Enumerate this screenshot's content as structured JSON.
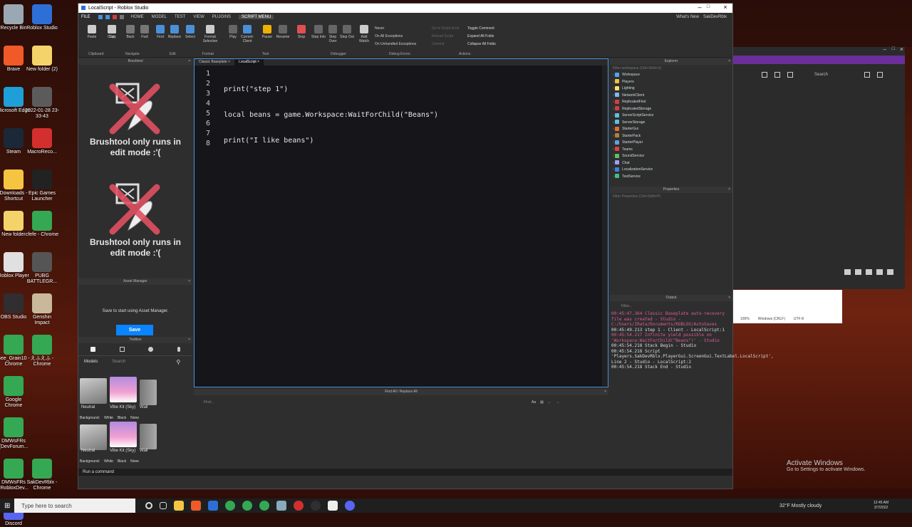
{
  "desktop": [
    {
      "label": "Recycle Bin",
      "color": "#9aa8b3"
    },
    {
      "label": "Roblox Studio",
      "color": "#2d6fd6"
    },
    {
      "label": "Brave",
      "color": "#f05a28"
    },
    {
      "label": "New folder (2)",
      "color": "#f5d36b"
    },
    {
      "label": "Microsoft Edge",
      "color": "#1e9fd8"
    },
    {
      "label": "2022-01-28 23-33-43",
      "color": "#5b5b5b"
    },
    {
      "label": "Steam",
      "color": "#1b2838"
    },
    {
      "label": "MacroReco...",
      "color": "#d32f2f"
    },
    {
      "label": "Downloads - Shortcut",
      "color": "#f5c542"
    },
    {
      "label": "Epic Games Launcher",
      "color": "#222"
    },
    {
      "label": "New folder",
      "color": "#f5d36b"
    },
    {
      "label": "cfefe - Chrome",
      "color": "#34a853"
    },
    {
      "label": "Roblox Player",
      "color": "#e0e0e0"
    },
    {
      "label": "PUBG BATTLEGR...",
      "color": "#555"
    },
    {
      "label": "OBS Studio",
      "color": "#302e31"
    },
    {
      "label": "Genshin Impact",
      "color": "#c9b99a"
    },
    {
      "label": "Bee_Grain10 - Chrome",
      "color": "#34a853"
    },
    {
      "label": "えふえふ - Chrome",
      "color": "#34a853"
    },
    {
      "label": "Google Chrome",
      "color": "#34a853"
    },
    {
      "label": "",
      "color": "#000"
    },
    {
      "label": "DMWsFRs (DevForum...",
      "color": "#34a853"
    },
    {
      "label": "",
      "color": "#000"
    },
    {
      "label": "DMWsFRs (RobloxDev...",
      "color": "#34a853"
    },
    {
      "label": "SakDevRblx - Chrome",
      "color": "#34a853"
    },
    {
      "label": "Discord",
      "color": "#5865f2"
    }
  ],
  "window": {
    "title": "LocalScript - Roblox Studio",
    "whats_new": "What's New",
    "user": "SakDevRblx"
  },
  "menu": [
    "FILE",
    "HOME",
    "MODEL",
    "TEST",
    "VIEW",
    "PLUGINS",
    "SCRIPT MENU"
  ],
  "ribbon": {
    "buttons": [
      "Paste",
      "Cut",
      "Copy",
      "Back",
      "Fwd",
      "Find",
      "Replace",
      "Select",
      "Format Selection",
      "Play",
      "Current: Client",
      "Pause",
      "Resume",
      "Stop",
      "Step Into",
      "Step Over",
      "Step Out",
      "Add Watch"
    ],
    "groups": [
      "Clipboard",
      "Navigate",
      "Edit",
      "Format",
      "Test",
      "Debugger",
      "Debug Errors",
      "Actions"
    ],
    "debug_errors": [
      "Never",
      "On All Exceptions",
      "On Unhandled Exceptions"
    ],
    "actions_left": [
      "Go to Script Error",
      "Reload Script",
      "Commit"
    ],
    "actions": [
      "Toggle Comment",
      "Expand All Folds",
      "Collapse All Folds"
    ]
  },
  "brushtool": {
    "title": "Brushtool",
    "message": "Brushtool only runs in edit mode :'("
  },
  "asset_manager": {
    "title": "Asset Manager",
    "message": "Save to start using Asset Manager.",
    "save": "Save"
  },
  "toolbox": {
    "title": "Toolbox",
    "category": "Models",
    "search": "Search",
    "items": [
      "Neutral",
      "Vibe Kit (Sky)",
      "Wall"
    ],
    "bg_label": "Background:",
    "bg_options": [
      "White",
      "Black",
      "None"
    ]
  },
  "editor": {
    "tabs": [
      "Classic Baseplate",
      "LocalScript"
    ],
    "lines": [
      "print(\"step 1\")",
      "local beans = game.Workspace:WaitForChild(\"Beans\")",
      "print(\"I like beans\")",
      "",
      "",
      "",
      "",
      ""
    ]
  },
  "explorer": {
    "title": "Explorer",
    "filter": "Filter workspace (Ctrl+Shift+X)",
    "items": [
      {
        "label": "Workspace",
        "color": "#4fa3ff"
      },
      {
        "label": "Players",
        "color": "#f0c040"
      },
      {
        "label": "Lighting",
        "color": "#f5e26b"
      },
      {
        "label": "NetworkClient",
        "color": "#7fb8ff"
      },
      {
        "label": "ReplicatedFirst",
        "color": "#d04040"
      },
      {
        "label": "ReplicatedStorage",
        "color": "#d04040"
      },
      {
        "label": "ServerScriptService",
        "color": "#60c0e0"
      },
      {
        "label": "ServerStorage",
        "color": "#60c0e0"
      },
      {
        "label": "StarterGui",
        "color": "#e07030"
      },
      {
        "label": "StarterPack",
        "color": "#b08040"
      },
      {
        "label": "StarterPlayer",
        "color": "#60a0e0"
      },
      {
        "label": "Teams",
        "color": "#e04040"
      },
      {
        "label": "SoundService",
        "color": "#60c060"
      },
      {
        "label": "Chat",
        "color": "#a0a0ff"
      },
      {
        "label": "LocalizationService",
        "color": "#4080e0"
      },
      {
        "label": "TestService",
        "color": "#40c080"
      }
    ]
  },
  "properties": {
    "title": "Properties",
    "filter": "Filter Properties (Ctrl+Shift+P)"
  },
  "output": {
    "title": "Output",
    "filter": "Filter...",
    "lines": [
      {
        "t": "00:45:47.364  Classic Baseplate auto-recovery file was created  -  Studio - C:/Users/IRata/Documents/ROBLOX/AutoSaves",
        "c": "#e05a9a"
      },
      {
        "t": "00:45:49.213  step 1  -  Client - LocalScript:1",
        "c": "#ddd"
      },
      {
        "t": "00:45:54.217  Infinite yield possible on 'Workspace:WaitForChild(\"Beans\")'  -  Studio",
        "c": "#e05a9a"
      },
      {
        "t": "00:45:54.218  Stack Begin  -  Studio",
        "c": "#ddd"
      },
      {
        "t": "00:45:54.218  Script 'Players.SakDevRblx.PlayerGui.ScreenGui.TextLabel.LocalScript', Line 2  -  Studio - LocalScript:2",
        "c": "#ddd"
      },
      {
        "t": "00:45:54.218  Stack End  -  Studio",
        "c": "#ddd"
      }
    ]
  },
  "find": {
    "title": "Find All / Replace All",
    "placeholder": "Find..."
  },
  "command": {
    "placeholder": "Run a command"
  },
  "side_window": {
    "search": "Search",
    "status": [
      "100%",
      "Windows (CRLF)",
      "UTF-8"
    ]
  },
  "activate": {
    "title": "Activate Windows",
    "sub": "Go to Settings to activate Windows."
  },
  "taskbar": {
    "search": "Type here to search",
    "weather": "32°F  Mostly cloudy",
    "time": "12:45 AM",
    "date": "2/7/2022"
  }
}
